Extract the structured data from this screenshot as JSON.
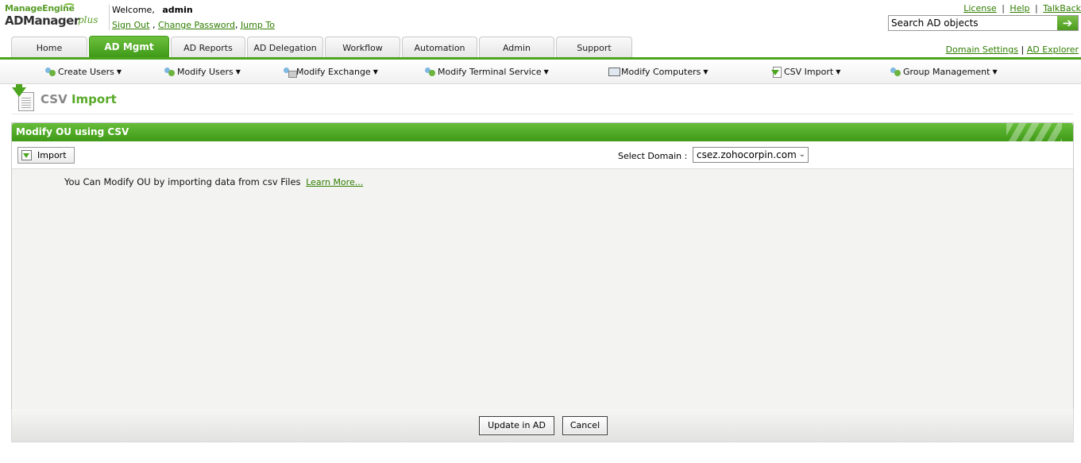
{
  "brand": {
    "company": "ManageEngine",
    "product": "ADManager",
    "edition": "plus"
  },
  "user": {
    "welcome_label": "Welcome,",
    "name": "admin",
    "sign_out": "Sign Out",
    "separator1": ",",
    "change_password": "Change Password",
    "separator2": ",",
    "jump_to": "Jump To"
  },
  "toplinks": {
    "license": "License",
    "help": "Help",
    "talkback": "TalkBack",
    "sep": "|"
  },
  "search": {
    "value": "Search AD objects",
    "go_icon": "arrow-right-icon"
  },
  "tabs": [
    {
      "label": "Home",
      "active": false
    },
    {
      "label": "AD Mgmt",
      "active": true
    },
    {
      "label": "AD Reports",
      "active": false
    },
    {
      "label": "AD Delegation",
      "active": false
    },
    {
      "label": "Workflow",
      "active": false
    },
    {
      "label": "Automation",
      "active": false
    },
    {
      "label": "Admin",
      "active": false
    },
    {
      "label": "Support",
      "active": false
    }
  ],
  "rightlinks": {
    "domain_settings": "Domain Settings",
    "sep": "|",
    "ad_explorer": "AD Explorer"
  },
  "submenu": [
    {
      "label": "Create Users",
      "icon": "users-add-icon"
    },
    {
      "label": "Modify Users",
      "icon": "users-edit-icon"
    },
    {
      "label": "Modify Exchange",
      "icon": "exchange-icon"
    },
    {
      "label": "Modify Terminal Service",
      "icon": "terminal-service-icon"
    },
    {
      "label": "Modify Computers",
      "icon": "computer-icon"
    },
    {
      "label": "CSV Import",
      "icon": "csv-import-icon"
    },
    {
      "label": "Group Management",
      "icon": "group-icon"
    }
  ],
  "page": {
    "title_part1": "CSV",
    "title_part2": "Import"
  },
  "panel": {
    "heading": "Modify OU using CSV",
    "import_button": "Import",
    "domain_label": "Select Domain :",
    "domain_value": "csez.zohocorpin.com",
    "info_text": "You Can Modify OU by importing data from csv Files",
    "learn_more": "Learn More..."
  },
  "footer": {
    "update_button": "Update in AD",
    "cancel_button": "Cancel"
  },
  "colors": {
    "brand_green": "#4ca51f",
    "link_green": "#2f7d00"
  }
}
